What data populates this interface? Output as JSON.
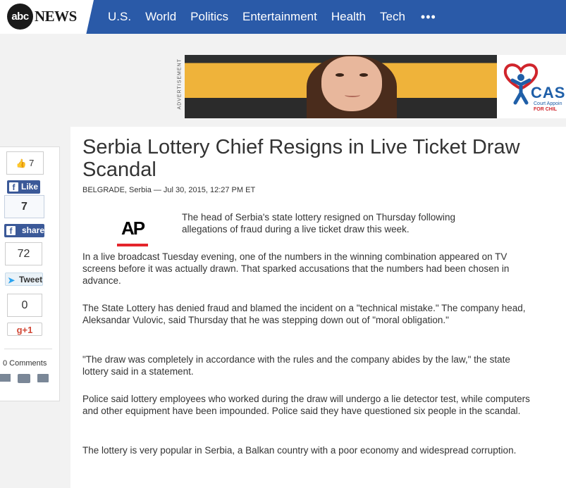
{
  "header": {
    "logo_mark": "abc",
    "logo_text": "NEWS",
    "nav": [
      "U.S.",
      "World",
      "Politics",
      "Entertainment",
      "Health",
      "Tech"
    ],
    "more_label": "•••",
    "brand_color": "#2a5aa8"
  },
  "ad": {
    "label": "ADVERTISEMENT",
    "brand_text": "CAS",
    "brand_sub1": "Court Appoin",
    "brand_sub2": "FOR CHIL"
  },
  "share": {
    "fb_like_count": "7",
    "fb_like_label": "Like",
    "fb_share_count": "7",
    "fb_share_label": "share",
    "tweet_count": "72",
    "tweet_label": "Tweet",
    "gplus_count": "0",
    "gplus_label": "g+1",
    "comments_label": "0 Comments"
  },
  "article": {
    "headline": "Serbia Lottery Chief Resigns in Live Ticket Draw Scandal",
    "dateline": "BELGRADE, Serbia — Jul 30, 2015, 12:27 PM ET",
    "source_logo": "AP",
    "paragraphs": [
      "The head of Serbia's state lottery resigned on Thursday following allegations of fraud during a live ticket draw this week.",
      "In a live broadcast Tuesday evening, one of the numbers in the winning combination appeared on TV screens before it was actually drawn. That sparked accusations that the numbers had been chosen in advance.",
      "The State Lottery has denied fraud and blamed the incident on a \"technical mistake.\" The company head, Aleksandar Vulovic, said Thursday that he was stepping down out of \"moral obligation.\"",
      "\"The draw was completely in accordance with the rules and the company abides by the law,\" the state lottery said in a statement.",
      "Police said lottery employees who worked during the draw will undergo a lie detector test, while computers and other equipment have been impounded. Police said they have questioned six people in the scandal.",
      "The lottery is very popular in Serbia, a Balkan country with a poor economy and widespread corruption."
    ]
  }
}
